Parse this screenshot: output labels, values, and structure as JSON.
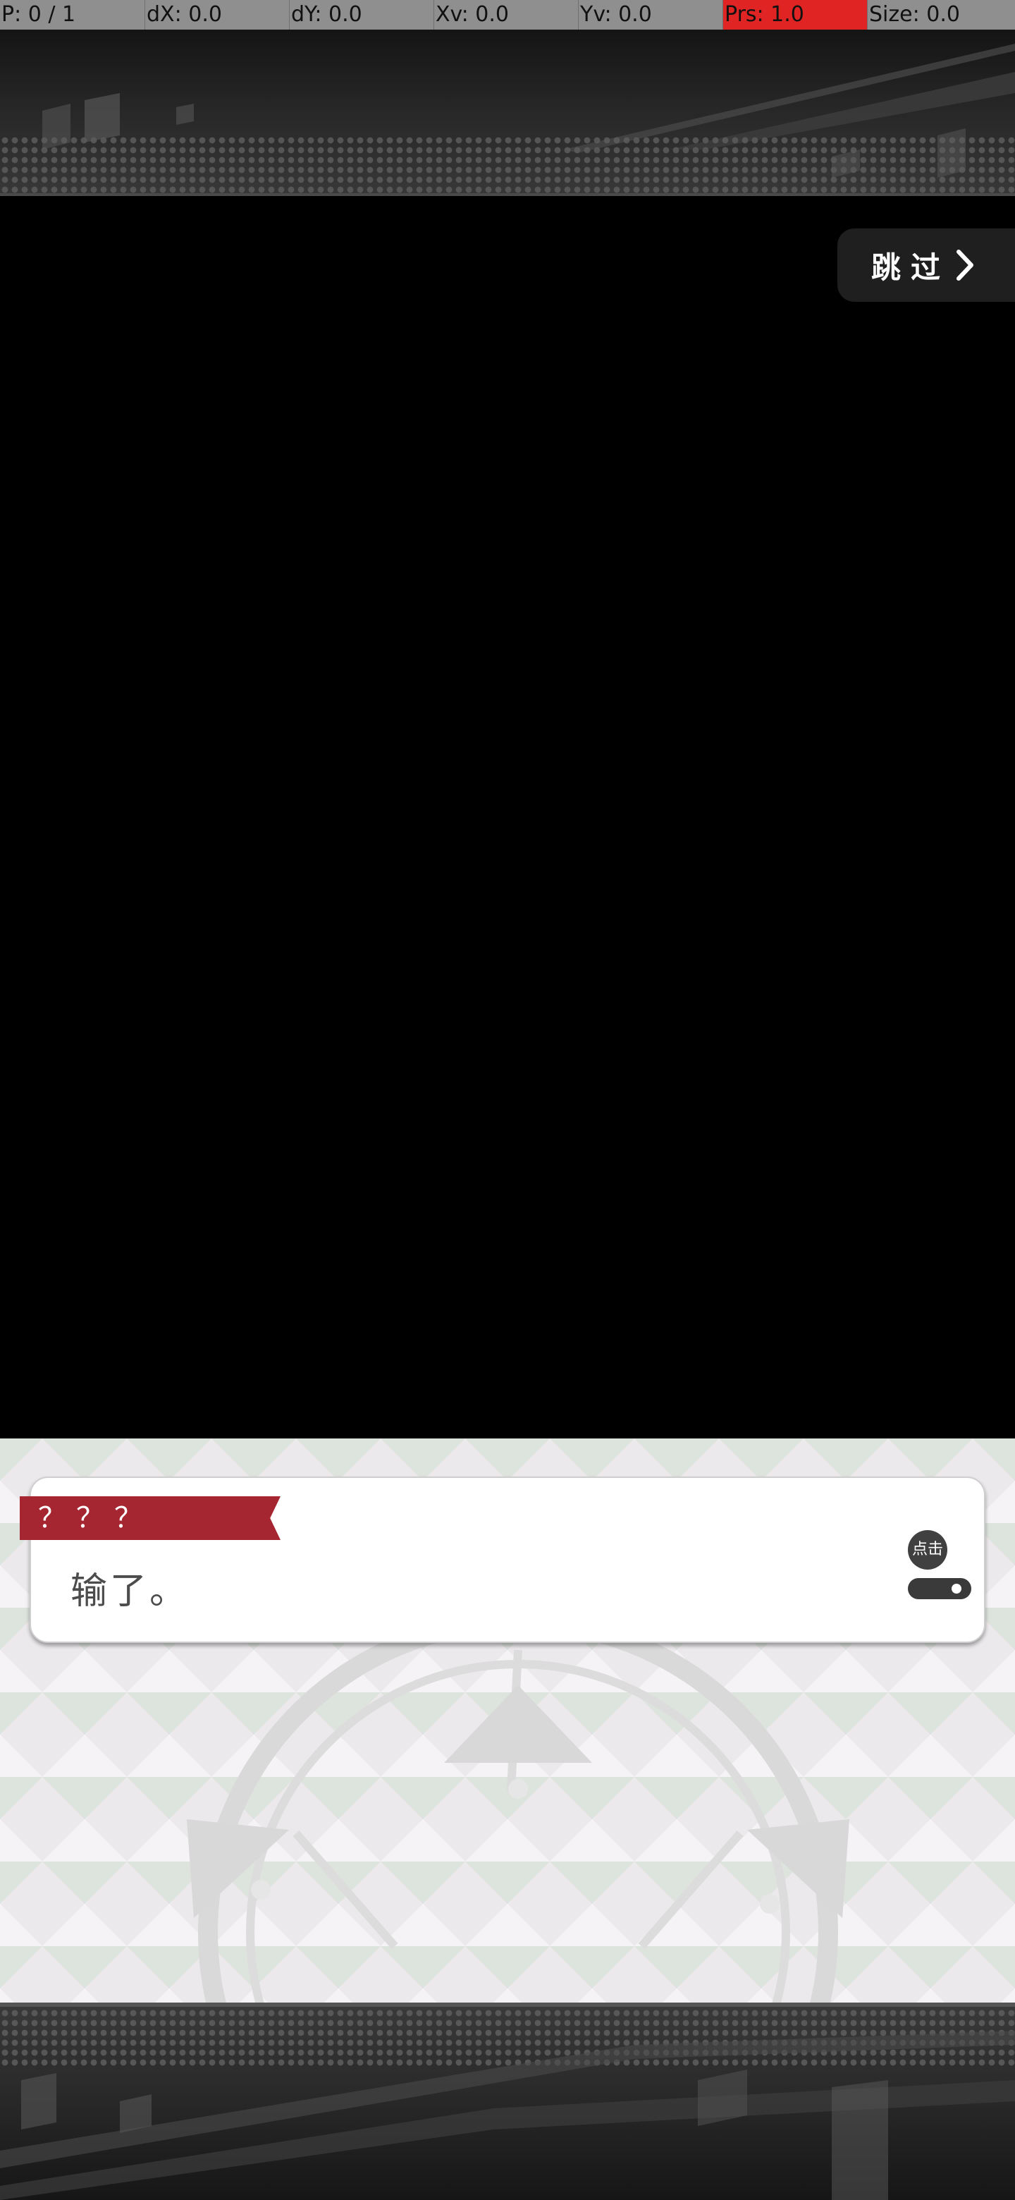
{
  "debug": {
    "pointer": "P: 0 / 1",
    "dx": "dX: 0.0",
    "dy": "dY: 0.0",
    "xv": "Xv: 0.0",
    "yv": "Yv: 0.0",
    "prs": "Prs: 1.0",
    "size": "Size: 0.0",
    "highlight_color": "#e02424"
  },
  "skip_button": {
    "label": "跳过",
    "icon": "chevron-right-icon"
  },
  "dialog": {
    "speaker": "？？？",
    "text": "输了。",
    "tap_hint": "点击",
    "accent_color": "#a52531"
  }
}
